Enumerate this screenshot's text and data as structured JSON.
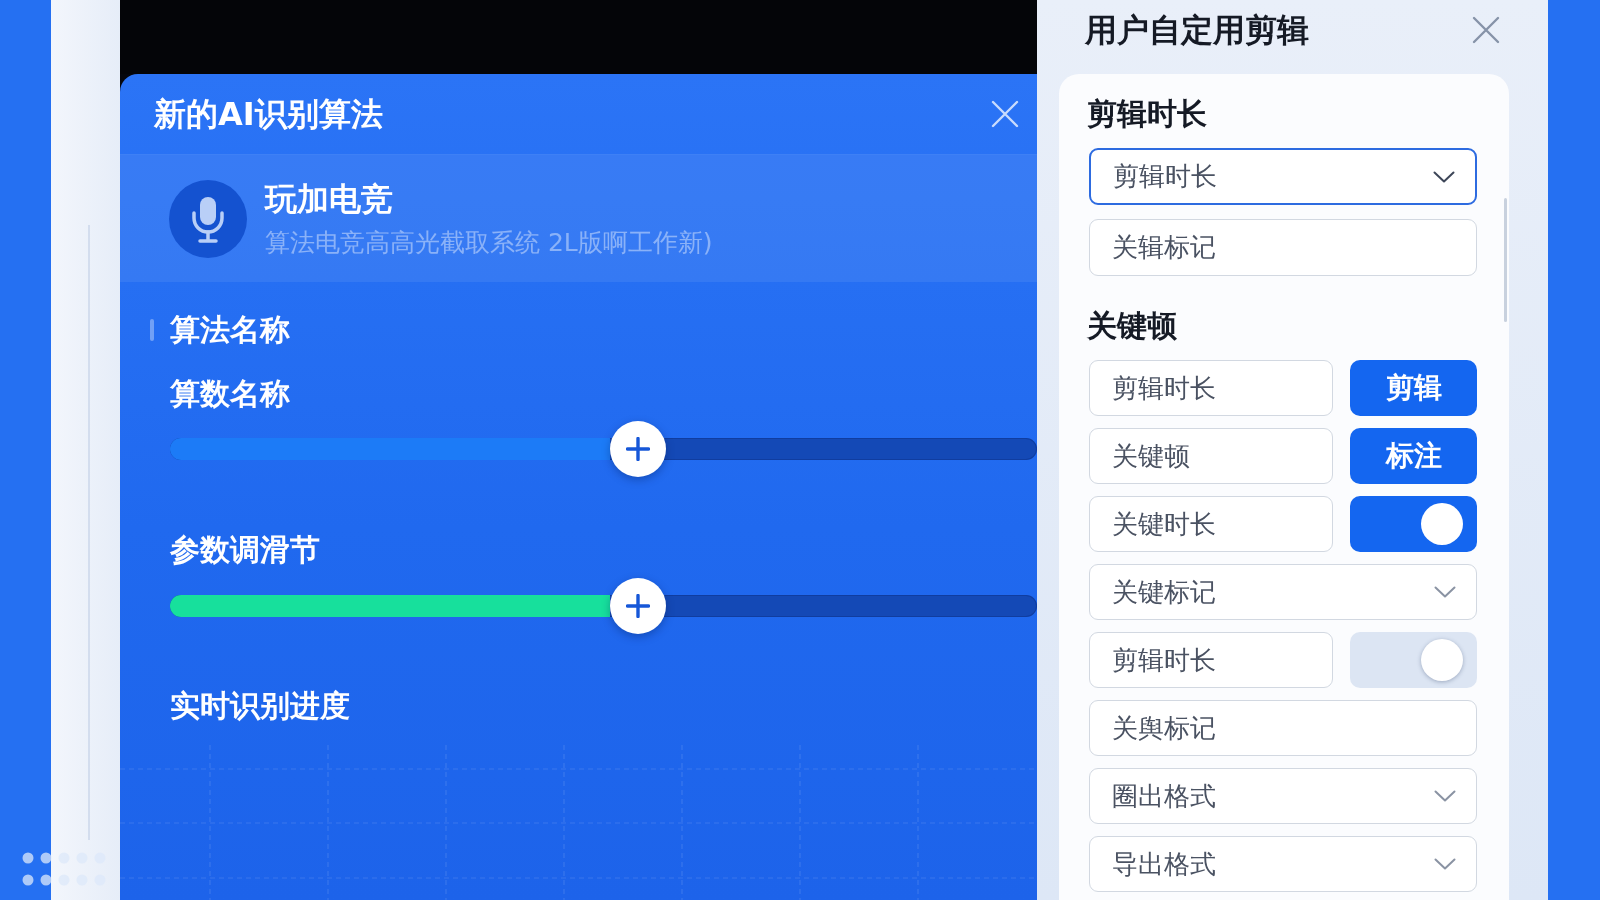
{
  "dialog": {
    "title": "新的AI识别算法",
    "profile": {
      "name": "玩加电竞",
      "subtitle": "算法电竞高高光截取系统 2L版啊工作新)"
    },
    "section_title": "算法名称",
    "sliders": [
      {
        "label": "算数名称",
        "level": 0.54,
        "color": "#1c7bf7"
      },
      {
        "label": "参数调滑节",
        "level": 0.54,
        "color": "#17e09c"
      }
    ],
    "progress_title": "实时识别进度"
  },
  "clip_panel": {
    "title": "用户自定用剪辑",
    "sections": [
      {
        "title": "剪辑时长",
        "rows": [
          {
            "kind": "select",
            "value": "剪辑时长",
            "focused": true
          },
          {
            "kind": "input",
            "value": "关辑标记",
            "focused": false
          }
        ]
      },
      {
        "title": "关键顿",
        "rows": [
          {
            "kind": "button",
            "value": "剪辑时长",
            "button": "剪辑",
            "focused": false
          },
          {
            "kind": "button",
            "value": "关键顿",
            "button": "标注",
            "focused": false
          },
          {
            "kind": "toggle",
            "value": "关键时长",
            "on": true,
            "focused": false
          },
          {
            "kind": "select",
            "value": "关键标记",
            "focused": false
          },
          {
            "kind": "toggle",
            "value": "剪辑时长",
            "on": false,
            "focused": false
          },
          {
            "kind": "input",
            "value": "关舆标记",
            "focused": false
          },
          {
            "kind": "select",
            "value": "圈出格式",
            "focused": false
          },
          {
            "kind": "select",
            "value": "导出格式",
            "focused": false
          }
        ]
      }
    ]
  }
}
